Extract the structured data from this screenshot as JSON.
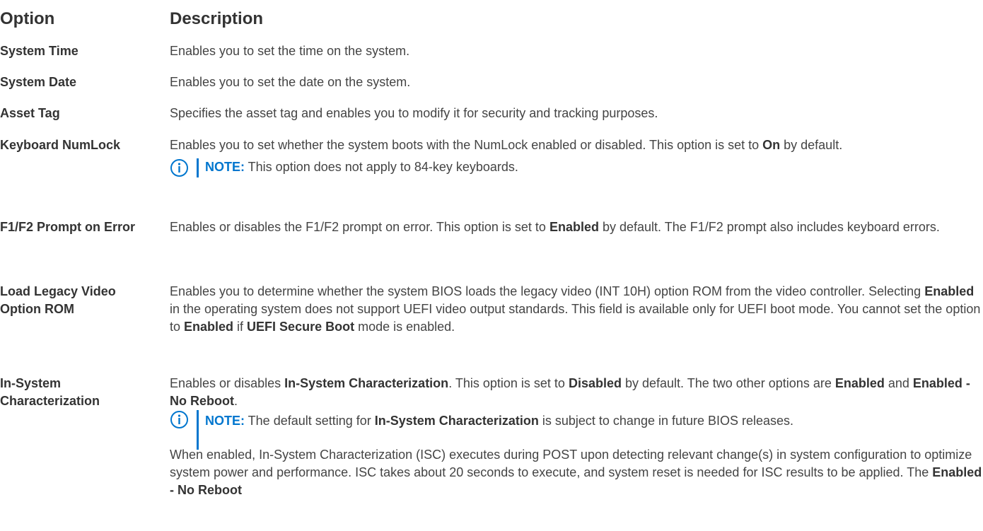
{
  "header": {
    "option": "Option",
    "description": "Description"
  },
  "rows": [
    {
      "option": "System Time",
      "description": "Enables you to set the time on the system."
    },
    {
      "option": "System Date",
      "description": "Enables you to set the date on the system."
    },
    {
      "option": "Asset Tag",
      "description": "Specifies the asset tag and enables you to modify it for security and tracking purposes."
    },
    {
      "option": "Keyboard NumLock",
      "description_parts": [
        "Enables you to set whether the system boots with the NumLock enabled or disabled. This option is set to ",
        "On",
        " by default."
      ],
      "note": {
        "label": "NOTE:",
        "text": " This option does not apply to 84-key keyboards."
      }
    },
    {
      "option": "F1/F2 Prompt on Error",
      "description_parts": [
        "Enables or disables the F1/F2 prompt on error. This option is set to ",
        "Enabled",
        " by default. The F1/F2 prompt also includes keyboard errors."
      ]
    },
    {
      "option": "Load Legacy Video Option ROM",
      "description_parts": [
        "Enables you to determine whether the system BIOS loads the legacy video (INT 10H) option ROM from the video controller. Selecting ",
        "Enabled",
        " in the operating system does not support UEFI video output standards. This field is available only for UEFI boot mode. You cannot set the option to ",
        "Enabled",
        " if ",
        "UEFI Secure Boot",
        " mode is enabled."
      ]
    },
    {
      "option": "In-System Characterization",
      "description_parts": [
        "Enables or disables ",
        "In-System Characterization",
        ". This option is set to ",
        "Disabled",
        " by default. The two other options are ",
        "Enabled",
        " and ",
        "Enabled - No Reboot",
        "."
      ],
      "note": {
        "label": "NOTE:",
        "parts": [
          " The default setting for ",
          "In-System Characterization",
          " is subject to change in future BIOS releases."
        ]
      },
      "paragraph_parts": [
        "When enabled, In-System Characterization (ISC) executes during POST upon detecting relevant change(s) in system configuration to optimize system power and performance. ISC takes about 20 seconds to execute, and system reset is needed for ISC results to be applied. The ",
        "Enabled - No Reboot"
      ]
    }
  ],
  "colors": {
    "note_accent": "#0076ce",
    "text": "#444444",
    "heading": "#333333"
  },
  "icons": {
    "note": "info-circle-icon"
  }
}
